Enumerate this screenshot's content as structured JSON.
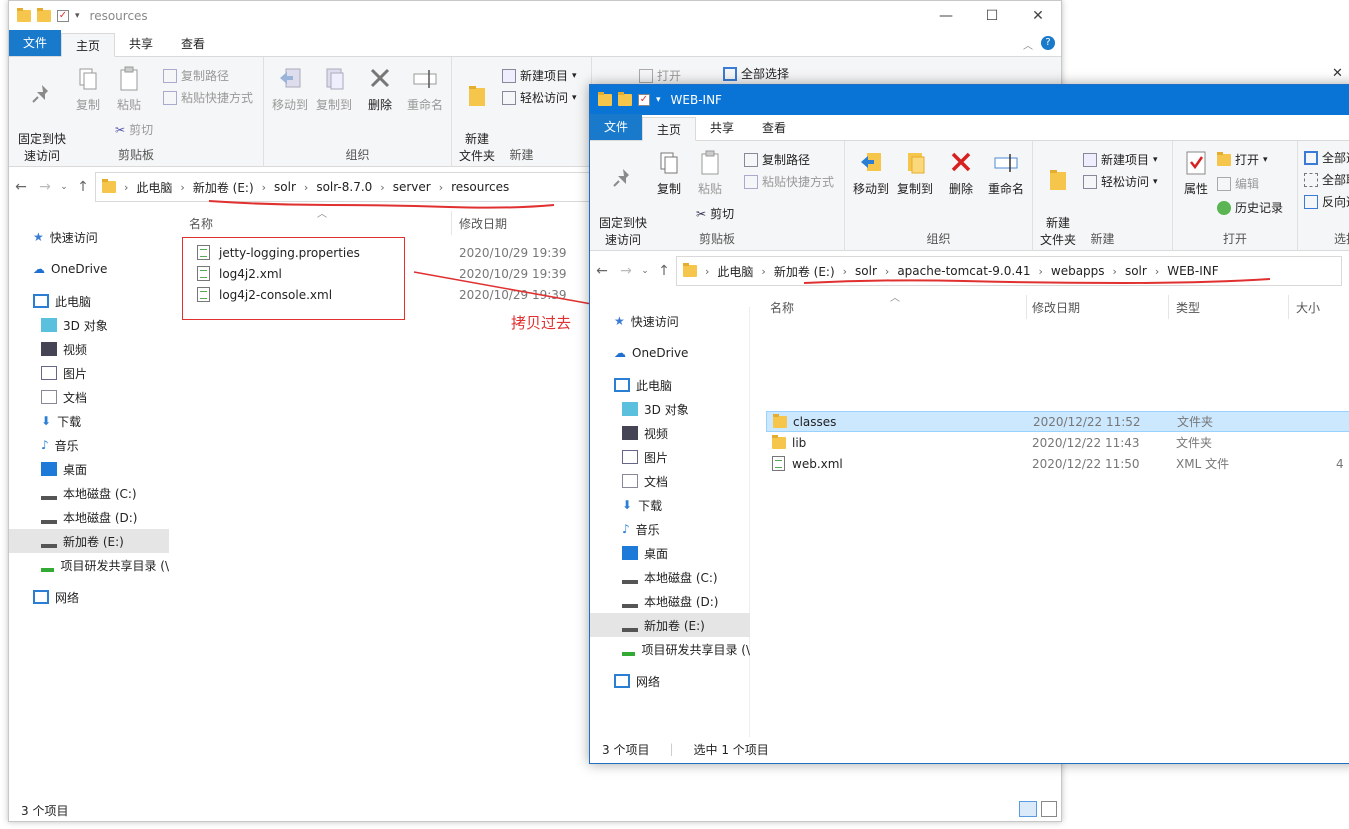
{
  "back_window": {
    "title": "resources",
    "tabs": [
      "文件",
      "主页",
      "共享",
      "查看"
    ],
    "ribbon": {
      "clipboard": {
        "pin": "固定到快\n速访问",
        "copy": "复制",
        "paste": "粘贴",
        "copy_path": "复制路径",
        "paste_shortcut": "粘贴快捷方式",
        "cut": "剪切",
        "label": "剪贴板"
      },
      "organize": {
        "move_to": "移动到",
        "copy_to": "复制到",
        "delete": "删除",
        "rename": "重命名",
        "label": "组织"
      },
      "new": {
        "new_folder": "新建\n文件夹",
        "new_item": "新建项目",
        "easy_access": "轻松访问",
        "label": "新建"
      },
      "open": {
        "open": "打开"
      },
      "select": {
        "select_all": "全部选择"
      }
    },
    "breadcrumb": [
      "此电脑",
      "新加卷 (E:)",
      "solr",
      "solr-8.7.0",
      "server",
      "resources"
    ],
    "columns": {
      "name": "名称",
      "date": "修改日期"
    },
    "files": [
      {
        "name": "jetty-logging.properties",
        "date": "2020/10/29 19:39"
      },
      {
        "name": "log4j2.xml",
        "date": "2020/10/29 19:39"
      },
      {
        "name": "log4j2-console.xml",
        "date": "2020/10/29 19:39"
      }
    ],
    "nav": [
      "快速访问",
      "OneDrive",
      "此电脑",
      "3D 对象",
      "视频",
      "图片",
      "文档",
      "下载",
      "音乐",
      "桌面",
      "本地磁盘 (C:)",
      "本地磁盘 (D:)",
      "新加卷 (E:)",
      "项目研发共享目录 (\\",
      "网络"
    ],
    "status": "3 个项目"
  },
  "front_window": {
    "title": "WEB-INF",
    "tabs": [
      "文件",
      "主页",
      "共享",
      "查看"
    ],
    "ribbon": {
      "clipboard": {
        "pin": "固定到快\n速访问",
        "copy": "复制",
        "paste": "粘贴",
        "copy_path": "复制路径",
        "paste_shortcut": "粘贴快捷方式",
        "cut": "剪切",
        "label": "剪贴板"
      },
      "organize": {
        "move_to": "移动到",
        "copy_to": "复制到",
        "delete": "删除",
        "rename": "重命名",
        "label": "组织"
      },
      "new": {
        "new_folder": "新建\n文件夹",
        "new_item": "新建项目",
        "easy_access": "轻松访问",
        "label": "新建"
      },
      "open": {
        "properties": "属性",
        "open": "打开",
        "edit": "编辑",
        "history": "历史记录",
        "label": "打开"
      },
      "select": {
        "select_all": "全部选",
        "select_none": "全部取",
        "invert": "反向选",
        "label": "选择"
      }
    },
    "breadcrumb": [
      "此电脑",
      "新加卷 (E:)",
      "solr",
      "apache-tomcat-9.0.41",
      "webapps",
      "solr",
      "WEB-INF"
    ],
    "columns": {
      "name": "名称",
      "date": "修改日期",
      "type": "类型",
      "size": "大小"
    },
    "files": [
      {
        "name": "classes",
        "date": "2020/12/22 11:52",
        "type": "文件夹",
        "size": ""
      },
      {
        "name": "lib",
        "date": "2020/12/22 11:43",
        "type": "文件夹",
        "size": ""
      },
      {
        "name": "web.xml",
        "date": "2020/12/22 11:50",
        "type": "XML 文件",
        "size": "4"
      }
    ],
    "nav": [
      "快速访问",
      "OneDrive",
      "此电脑",
      "3D 对象",
      "视频",
      "图片",
      "文档",
      "下载",
      "音乐",
      "桌面",
      "本地磁盘 (C:)",
      "本地磁盘 (D:)",
      "新加卷 (E:)",
      "项目研发共享目录 (\\",
      "网络"
    ],
    "status": {
      "count": "3 个项目",
      "selected": "选中 1 个项目"
    }
  },
  "annotation": {
    "text": "拷贝过去",
    "color": "#e03030"
  }
}
